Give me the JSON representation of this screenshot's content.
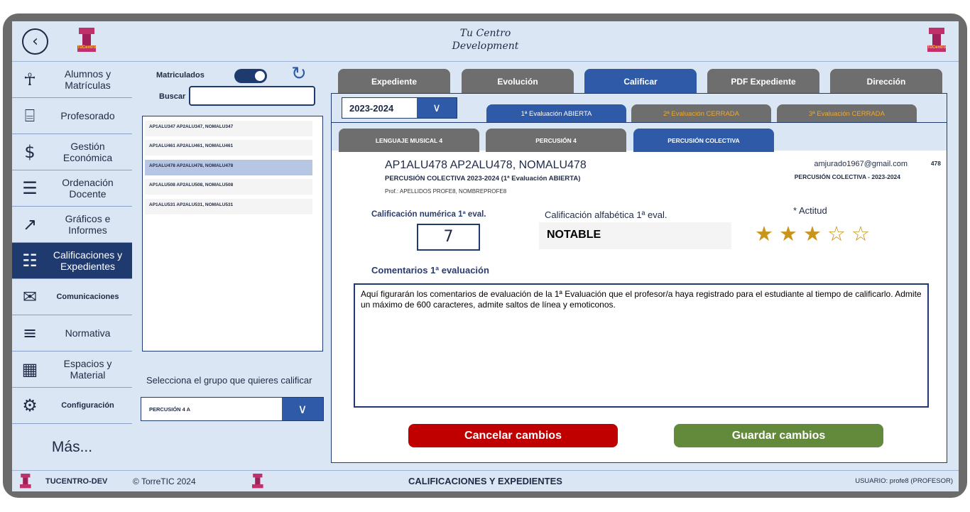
{
  "header": {
    "title_line1": "Tu Centro",
    "title_line2": "Development",
    "logo_text": "TuCentro"
  },
  "sidebar": {
    "items": [
      {
        "label": "Alumnos y Matrículas",
        "icon": "users-icon"
      },
      {
        "label": "Profesorado",
        "icon": "id-badge-icon"
      },
      {
        "label": "Gestión Económica",
        "icon": "money-icon"
      },
      {
        "label": "Ordenación Docente",
        "icon": "list-icon"
      },
      {
        "label": "Gráficos e Informes",
        "icon": "chart-icon"
      },
      {
        "label": "Calificaciones y Expedientes",
        "icon": "document-icon"
      },
      {
        "label": "Comunicaciones",
        "icon": "mail-icon"
      },
      {
        "label": "Normativa",
        "icon": "scroll-icon"
      },
      {
        "label": "Espacios y Material",
        "icon": "building-icon"
      },
      {
        "label": "Configuración",
        "icon": "gear-icon"
      }
    ],
    "more": "Más...",
    "active_index": 5
  },
  "students": {
    "enrolled_label": "Matriculados",
    "enrolled_on": true,
    "search_label": "Buscar",
    "search_value": "",
    "list": [
      "AP1ALU347 AP2ALU347, NOMALU347",
      "AP1ALU461 AP2ALU461, NOMALU461",
      "AP1ALU478 AP2ALU478, NOMALU478",
      "AP1ALU508 AP2ALU508, NOMALU508",
      "AP1ALU531 AP2ALU531, NOMALU531"
    ],
    "selected_index": 2,
    "group_prompt": "Selecciona el grupo que quieres calificar",
    "group_value": "PERCUSIÓN 4 A"
  },
  "tabs": [
    "Expediente",
    "Evolución",
    "Calificar",
    "PDF Expediente",
    "Dirección"
  ],
  "active_tab": 2,
  "panel": {
    "year": "2023-2024",
    "eval_tabs": [
      {
        "label": "1ª Evaluación ABIERTA",
        "state": "open"
      },
      {
        "label": "2ª Evaluación CERRADA",
        "state": "closed"
      },
      {
        "label": "3ª Evaluación CERRADA",
        "state": "closed"
      }
    ],
    "subject_tabs": [
      "LENGUAJE MUSICAL 4",
      "PERCUSIÓN 4",
      "PERCUSIÓN COLECTIVA"
    ],
    "active_subject": 2
  },
  "student": {
    "name": "AP1ALU478 AP2ALU478, NOMALU478",
    "subject_line": "PERCUSIÓN COLECTIVA  2023-2024  (1ª Evaluación  ABIERTA)",
    "professor": "Prof.: APELLIDOS PROFE8, NOMBREPROFE8",
    "email": "amjurado1967@gmail.com",
    "id": "478",
    "group_year": "PERCUSIÓN COLECTIVA  -  2023-2024"
  },
  "grades": {
    "numeric_label": "Calificación numérica 1ª eval.",
    "numeric_value": "7",
    "alpha_label": "Calificación alfabética 1ª eval.",
    "alpha_value": "NOTABLE",
    "attitude_label": "*   Actitud",
    "attitude_stars": 3,
    "attitude_max": 5
  },
  "comments": {
    "label": "Comentarios 1ª evaluación",
    "text": "Aquí figurarán los comentarios de evaluación de la 1ª Evaluación que el profesor/a haya registrado para el estudiante al tiempo de calificarlo. Admite un máximo de 600 caracteres, admite saltos de línea y emoticonos."
  },
  "buttons": {
    "cancel": "Cancelar cambios",
    "save": "Guardar cambios"
  },
  "footer": {
    "org": "TUCENTRO-DEV",
    "copyright": "© TorreTIC  2024",
    "section": "CALIFICACIONES Y EXPEDIENTES",
    "user": "USUARIO: profe8 (PROFESOR)"
  },
  "colors": {
    "accent": "#2e5aa8",
    "nav_active": "#1e3a6e",
    "panel_bg": "#dbe6f5",
    "cancel": "#c00000",
    "save": "#63893a",
    "star": "#c8941a",
    "closed_eval": "#f0a82a"
  }
}
